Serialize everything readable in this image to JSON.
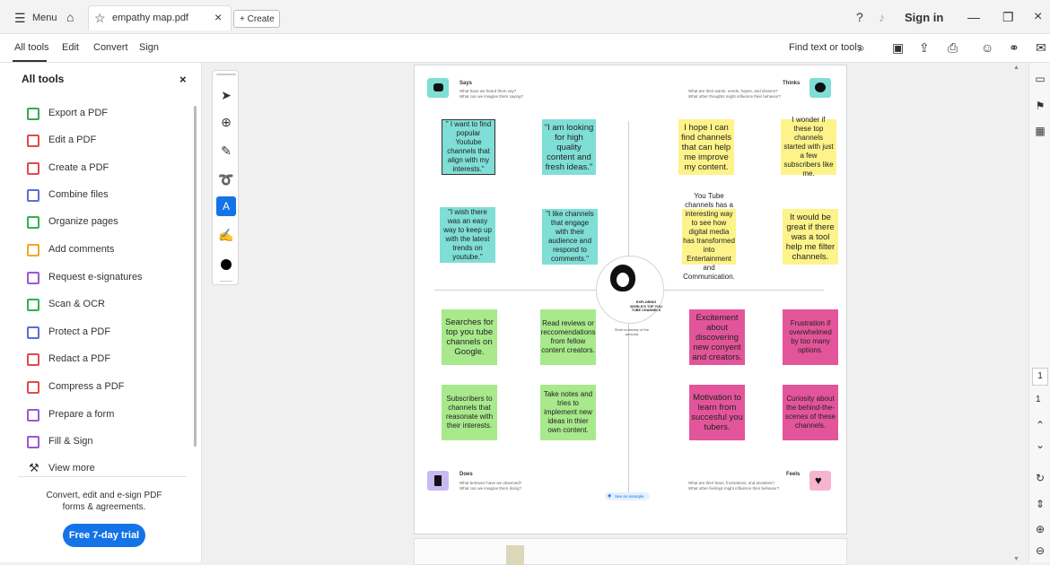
{
  "titlebar": {
    "menu_label": "Menu",
    "tab_title": "empathy map.pdf",
    "create_label": "+ Create",
    "sign_in": "Sign in"
  },
  "menubar": {
    "items": [
      "All tools",
      "Edit",
      "Convert",
      "Sign"
    ],
    "find_label": "Find text or tools"
  },
  "sidebar": {
    "title": "All tools",
    "items": [
      {
        "label": "Export a PDF",
        "color": "#3aa655"
      },
      {
        "label": "Edit a PDF",
        "color": "#e34850"
      },
      {
        "label": "Create a PDF",
        "color": "#e34850"
      },
      {
        "label": "Combine files",
        "color": "#5a6dd8"
      },
      {
        "label": "Organize pages",
        "color": "#2fb34c"
      },
      {
        "label": "Add comments",
        "color": "#f5a623"
      },
      {
        "label": "Request e-signatures",
        "color": "#9b59d0"
      },
      {
        "label": "Scan & OCR",
        "color": "#2fb34c"
      },
      {
        "label": "Protect a PDF",
        "color": "#5a6dd8"
      },
      {
        "label": "Redact a PDF",
        "color": "#e34850"
      },
      {
        "label": "Compress a PDF",
        "color": "#e34850"
      },
      {
        "label": "Prepare a form",
        "color": "#9b59d0"
      },
      {
        "label": "Fill & Sign",
        "color": "#9b59d0"
      }
    ],
    "view_more": "View more",
    "promo_text": "Convert, edit and e-sign PDF forms & agreements.",
    "trial_button": "Free 7-day trial"
  },
  "page": {
    "says": {
      "title": "Says",
      "sub1": "What have we heard them say?",
      "sub2": "What can we imagine them saying?"
    },
    "thinks": {
      "title": "Thinks",
      "sub1": "What are their wants, needs, hopes, and dreams?",
      "sub2": "What other thoughts might influence their behavior?"
    },
    "does": {
      "title": "Does",
      "sub1": "What behavior have we observed?",
      "sub2": "What can we imagine them doing?"
    },
    "feels": {
      "title": "Feels",
      "sub1": "What are their fears, frustrations, and anxieties?",
      "sub2": "What other feelings might influence their behavior?"
    },
    "center_title": "EXPLORING WORLD'S TOP YOU TUBE CHANNELS",
    "center_sub": "Short summary of the persona",
    "see_example": "See an example",
    "stickies": {
      "s1": "\" I want to find popular Youtube channels that align with my interests.\"",
      "s2": "\"I am looking for high quality content and fresh ideas.\"",
      "s3": "\"I wish there was an easy way to keep up with the latest trends on youtube.\"",
      "s4": "\"I like channels that engage with their audience and respond to comments.\"",
      "t1": "I hope I can find channels that can help me improve my content.",
      "t2": "I wonder if these top channels started with just a few subscribers like me.",
      "t3": "You Tube channels has a interesting way to see how digital media has transformed into Entertainment and Communication.",
      "t4": "It would be great if there was a tool help me filter channels.",
      "d1": "Searches for top you tube channels on Google.",
      "d2": "Read reviews or reccomendations from fellow content creators.",
      "d3": "Subscribers to channels that reasonate with their interests.",
      "d4": "Take notes and tries to implement new ideas in thier own content.",
      "f1": "Excitement about discovering new conyent and creators.",
      "f2": "Frustration if overwhelmed by too many options.",
      "f3": "Motivation to learn from succesful you tubers.",
      "f4": "Curiosity about the behind-the-scenes of these channels."
    }
  },
  "rightrail": {
    "page_box": "1",
    "page_total": "1"
  },
  "colors": {
    "teal": "#7fded6",
    "yellow": "#fdf38a",
    "green": "#a8e98c",
    "pink": "#e3559a",
    "accent_blue": "#1473e6"
  }
}
